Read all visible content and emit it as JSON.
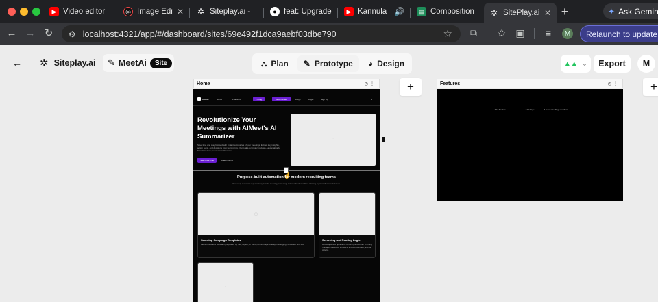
{
  "browser": {
    "tabs": [
      {
        "label": "Video editor",
        "icon": "youtube-icon"
      },
      {
        "label": "Image Editor",
        "icon": "image-editor-icon"
      },
      {
        "label": "Siteplay.ai -",
        "icon": "siteplay-icon"
      },
      {
        "label": "feat: Upgrade",
        "icon": "github-icon"
      },
      {
        "label": "Kannula",
        "icon": "youtube-icon"
      },
      {
        "label": "Composition",
        "icon": "composition-icon"
      },
      {
        "label": "SitePlay.ai |",
        "icon": "siteplay-icon"
      }
    ],
    "active_tab_index": 6,
    "ask_gemini": "Ask Gemini",
    "url": "localhost:4321/app/#/dashboard/sites/69e492f1dca9aebf03dbe790",
    "profile_initial": "M",
    "relaunch": "Relaunch to update",
    "colors": {
      "tabbar": "#202124",
      "toolbar": "#35363a",
      "relaunch": "#3b3d8a"
    }
  },
  "app": {
    "brand": "Siteplay.ai",
    "project": "MeetAi",
    "project_badge": "Site",
    "view_tabs": [
      {
        "label": "Plan",
        "icon": "sitemap-icon"
      },
      {
        "label": "Prototype",
        "icon": "pencil-icon",
        "active": true
      },
      {
        "label": "Design",
        "icon": "palette-icon"
      }
    ],
    "export_label": "Export",
    "user_initial": "M",
    "accent": "#22c55e"
  },
  "frames": {
    "home": {
      "title": "Home",
      "nav": {
        "logo": "AIMeet",
        "links": [
          "Home",
          "Features",
          "Pricing",
          "Testimonials",
          "FAQs",
          "Login",
          "Sign Up"
        ],
        "highlight_links": [
          "Pricing",
          "Testimonials"
        ]
      },
      "hero": {
        "heading": "Revolutionize Your Meetings with AIMeet's AI Summarizer",
        "subtext": "Save time and stay focused with instant summaries of your meetings. Extract key insights, action items, and decisions from team syncs, client calls, or project reviews—automatically. Transform how your team collaborates.",
        "cta_primary": "Start Free Trial",
        "cta_secondary": "Watch Demo"
      },
      "section": {
        "heading": "Purpose-built automation for modern recruiting teams",
        "subtext": "One every recruiter a repeatable system for sourcing, screening, and coordination without stitching together disconnected tools."
      },
      "cards": [
        {
          "title": "Sourcing Campaign Templates",
          "desc": "Launch reusable outreach playbooks by role, region, or hiring funnel stage to keep messaging consistent and fast."
        },
        {
          "title": "Screening and Routing Logic",
          "desc": "Route qualified applicants to the right recruiter or hiring manager based on answers, score thresholds, and job criteria."
        }
      ]
    },
    "features": {
      "title": "Features",
      "actions": [
        "Add Section",
        "Add Page",
        "Generate Page Sections"
      ]
    }
  }
}
